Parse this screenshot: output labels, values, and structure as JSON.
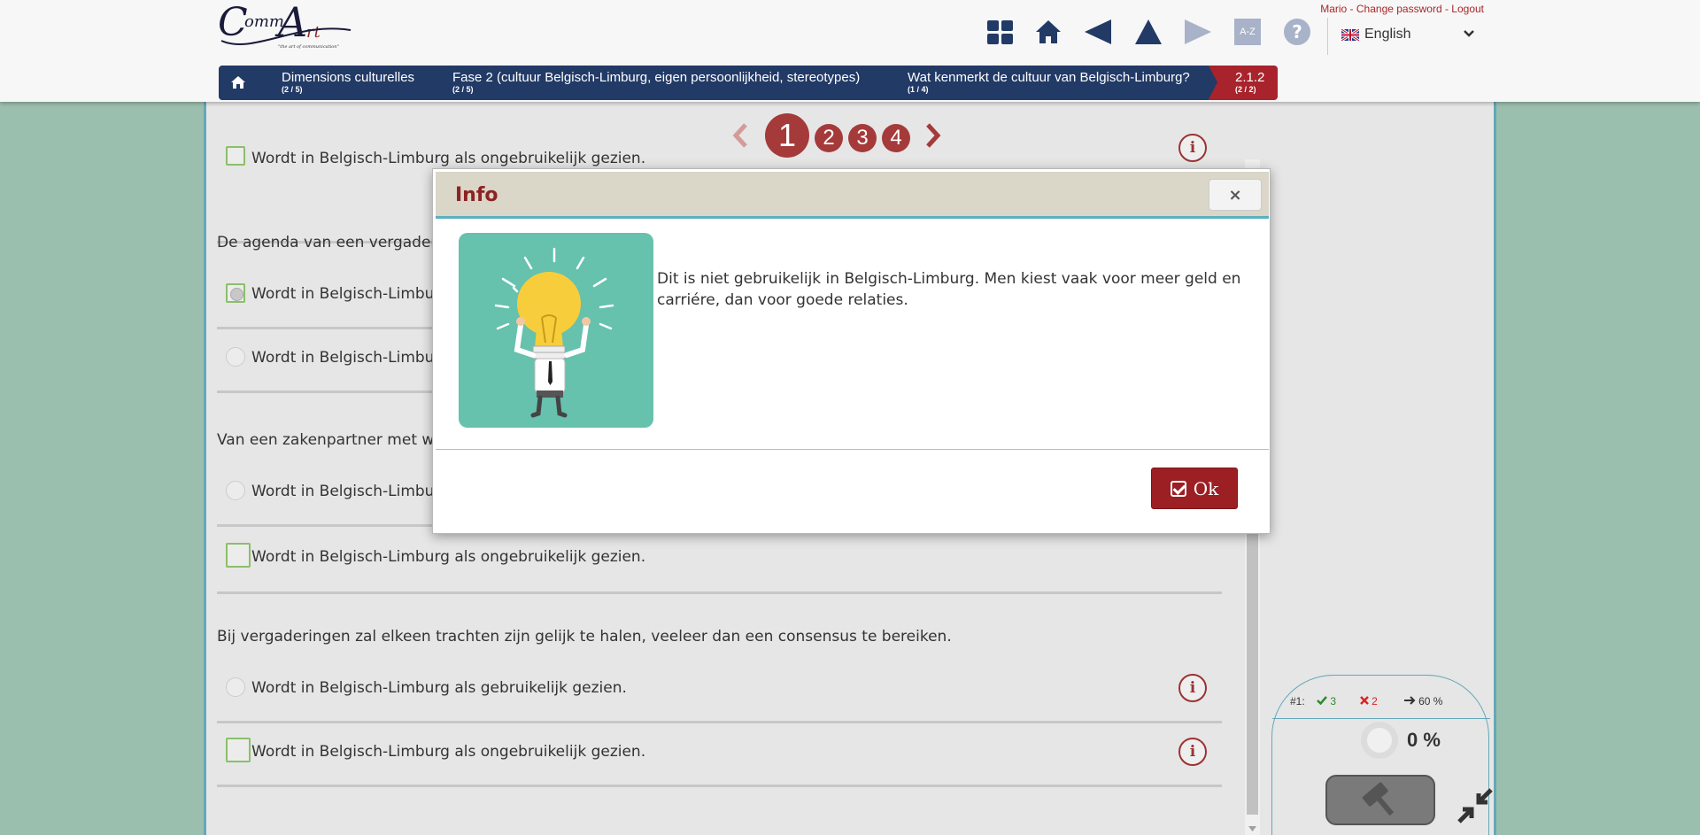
{
  "user_links": {
    "user": "Mario",
    "sep1": " - ",
    "change_password": "Change password",
    "sep2": " - ",
    "logout": "Logout"
  },
  "logo": {
    "letter_c": "C",
    "omm": "omm",
    "letter_a": "A",
    "rt": "rt",
    "tagline": "\"the art of communication\""
  },
  "toolbar": {
    "az_label": "A-Z",
    "help_label": "?"
  },
  "language": {
    "selected": "English"
  },
  "breadcrumb": [
    {
      "title": "Dimensions culturelles",
      "sub": "(2 / 5)"
    },
    {
      "title": "Fase 2 (cultuur Belgisch-Limburg, eigen persoonlijkheid, stereotypes)",
      "sub": "(2 / 5)"
    },
    {
      "title": "Wat kenmerkt de cultuur van Belgisch-Limburg?",
      "sub": "(1 / 4)"
    },
    {
      "title": "2.1.2",
      "sub": "(2 / 2)"
    }
  ],
  "pagination": {
    "pages": [
      "1",
      "2",
      "3",
      "4"
    ],
    "current": "1"
  },
  "questions": [
    {
      "text": "",
      "answers": [
        {
          "label": "Wordt in Belgisch-Limburg als ongebruikelijk gezien.",
          "selected": true
        }
      ]
    },
    {
      "text": "De agenda van een vergaderir",
      "answers": [
        {
          "label": "Wordt in Belgisch-Limburg",
          "selected": true
        },
        {
          "label": "Wordt in Belgisch-Limburg",
          "selected": false
        }
      ]
    },
    {
      "text": "Van een zakenpartner met wie",
      "answers": [
        {
          "label": "Wordt in Belgisch-Limburg",
          "selected": false
        },
        {
          "label": "Wordt in Belgisch-Limburg als ongebruikelijk gezien.",
          "selected": true
        }
      ]
    },
    {
      "text": "Bij vergaderingen zal elkeen trachten zijn gelijk te halen, veeleer dan een consensus te bereiken.",
      "answers": [
        {
          "label": "Wordt in Belgisch-Limburg als gebruikelijk gezien.",
          "selected": false
        },
        {
          "label": "Wordt in Belgisch-Limburg als ongebruikelijk gezien.",
          "selected": true
        }
      ]
    }
  ],
  "info_icon_letter": "i",
  "stats": {
    "attempt": "#1:",
    "correct": "3",
    "wrong": "2",
    "score": "60 %",
    "progress": "0 %"
  },
  "modal": {
    "title": "Info",
    "close_label": "×",
    "text": "Dit is niet gebruikelijk in Belgisch-Limburg. Men kiest vaak voor meer geld en carriére, dan voor goede relaties.",
    "ok_label": "Ok"
  },
  "colors": {
    "brand_red": "#9c1f23",
    "navy": "#223a66",
    "teal": "#63a8b8",
    "background": "#9bbfae"
  },
  "icons": [
    "grid-icon",
    "home-icon",
    "back-icon",
    "up-icon",
    "forward-icon",
    "az-icon",
    "help-icon",
    "flag-uk-icon",
    "chevron-down-icon",
    "breadcrumb-home-icon",
    "info-icon",
    "check-icon",
    "cross-icon",
    "arrow-right-icon",
    "gavel-icon",
    "collapse-icon",
    "lightbulb-illustration",
    "checkbox-icon"
  ]
}
